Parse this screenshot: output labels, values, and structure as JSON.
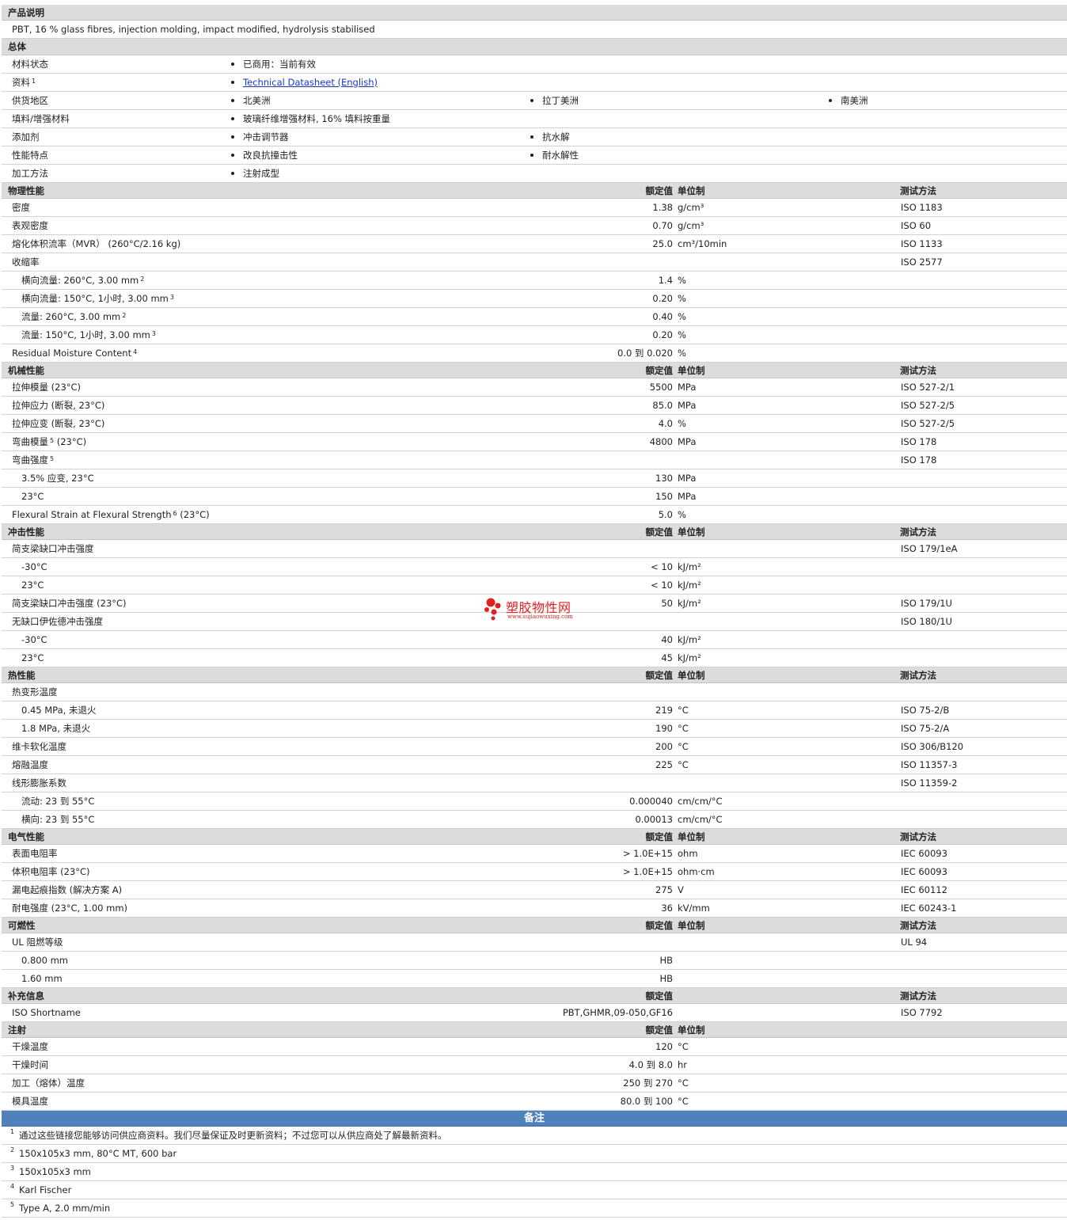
{
  "sections": [
    {
      "type": "hdr",
      "name": "产品说明"
    },
    {
      "type": "desc",
      "text": "PBT, 16 % glass fibres, injection molding, impact modified, hydrolysis stabilised"
    },
    {
      "type": "hdr",
      "name": "总体",
      "cls": "gen-hdr"
    },
    {
      "type": "gen",
      "label": "材料状态",
      "items": [
        "已商用：当前有效"
      ]
    },
    {
      "type": "gen",
      "label": "资料",
      "sup": "1",
      "items": [
        "Technical Datasheet (English)"
      ],
      "link": true
    },
    {
      "type": "gen",
      "label": "供货地区",
      "items": [
        "北美洲",
        "拉丁美洲",
        "南美洲"
      ]
    },
    {
      "type": "gen",
      "label": "填料/增强材料",
      "items": [
        "玻璃纤维增强材料, 16% 填料按重量"
      ]
    },
    {
      "type": "gen",
      "label": "添加剂",
      "items": [
        "冲击调节器",
        "抗水解"
      ]
    },
    {
      "type": "gen",
      "label": "性能特点",
      "items": [
        "改良抗撞击性",
        "耐水解性"
      ]
    },
    {
      "type": "gen",
      "label": "加工方法",
      "items": [
        "注射成型"
      ]
    },
    {
      "type": "hdr",
      "name": "物理性能",
      "h_val": "额定值",
      "h_unit": "单位制",
      "h_test": "测试方法"
    },
    {
      "type": "prop",
      "label": "密度",
      "value": "1.38",
      "unit": "g/cm³",
      "test": "ISO 1183"
    },
    {
      "type": "prop",
      "label": "表观密度",
      "value": "0.70",
      "unit": "g/cm³",
      "test": "ISO 60"
    },
    {
      "type": "prop",
      "label": "熔化体积流率（MVR） (260°C/2.16 kg)",
      "value": "25.0",
      "unit": "cm³/10min",
      "test": "ISO 1133"
    },
    {
      "type": "prop",
      "label": "收缩率",
      "test": "ISO 2577"
    },
    {
      "type": "prop",
      "sub": true,
      "label": "横向流量: 260°C, 3.00 mm",
      "sup": "2",
      "value": "1.4",
      "unit": "%"
    },
    {
      "type": "prop",
      "sub": true,
      "label": "横向流量: 150°C, 1小时, 3.00 mm",
      "sup": "3",
      "value": "0.20",
      "unit": "%"
    },
    {
      "type": "prop",
      "sub": true,
      "label": "流量: 260°C, 3.00 mm",
      "sup": "2",
      "value": "0.40",
      "unit": "%"
    },
    {
      "type": "prop",
      "sub": true,
      "label": "流量: 150°C, 1小时, 3.00 mm",
      "sup": "3",
      "value": "0.20",
      "unit": "%"
    },
    {
      "type": "prop",
      "label": "Residual Moisture Content",
      "sup": "4",
      "value": "0.0 到  0.020",
      "unit": "%"
    },
    {
      "type": "hdr",
      "name": "机械性能",
      "h_val": "额定值",
      "h_unit": "单位制",
      "h_test": "测试方法"
    },
    {
      "type": "prop",
      "label": "拉伸模量 (23°C)",
      "value": "5500",
      "unit": "MPa",
      "test": "ISO 527-2/1"
    },
    {
      "type": "prop",
      "label": "拉伸应力 (断裂, 23°C)",
      "value": "85.0",
      "unit": "MPa",
      "test": "ISO 527-2/5"
    },
    {
      "type": "prop",
      "label": "拉伸应变 (断裂, 23°C)",
      "value": "4.0",
      "unit": "%",
      "test": "ISO 527-2/5"
    },
    {
      "type": "prop",
      "label": "弯曲模量",
      "sup": "5",
      "label2": " (23°C)",
      "value": "4800",
      "unit": "MPa",
      "test": "ISO 178"
    },
    {
      "type": "prop",
      "label": "弯曲强度",
      "sup": "5",
      "test": "ISO 178"
    },
    {
      "type": "prop",
      "sub": true,
      "label": "3.5% 应变, 23°C",
      "value": "130",
      "unit": "MPa"
    },
    {
      "type": "prop",
      "sub": true,
      "label": "23°C",
      "value": "150",
      "unit": "MPa"
    },
    {
      "type": "prop",
      "label": "Flexural Strain at Flexural Strength",
      "sup": "6",
      "label2": " (23°C)",
      "value": "5.0",
      "unit": "%"
    },
    {
      "type": "hdr",
      "name": "冲击性能",
      "h_val": "额定值",
      "h_unit": "单位制",
      "h_test": "测试方法"
    },
    {
      "type": "prop",
      "label": "简支梁缺口冲击强度",
      "test": "ISO 179/1eA"
    },
    {
      "type": "prop",
      "sub": true,
      "label": "-30°C",
      "value": "< 10",
      "unit": "kJ/m²"
    },
    {
      "type": "prop",
      "sub": true,
      "label": "23°C",
      "value": "< 10",
      "unit": "kJ/m²"
    },
    {
      "type": "prop",
      "label": "简支梁缺口冲击强度 (23°C)",
      "value": "50",
      "unit": "kJ/m²",
      "test": "ISO 179/1U"
    },
    {
      "type": "prop",
      "label": "无缺口伊佐德冲击强度",
      "test": "ISO 180/1U"
    },
    {
      "type": "prop",
      "sub": true,
      "label": "-30°C",
      "value": "40",
      "unit": "kJ/m²"
    },
    {
      "type": "prop",
      "sub": true,
      "label": "23°C",
      "value": "45",
      "unit": "kJ/m²"
    },
    {
      "type": "hdr",
      "name": "热性能",
      "h_val": "额定值",
      "h_unit": "单位制",
      "h_test": "测试方法"
    },
    {
      "type": "prop",
      "label": "热变形温度"
    },
    {
      "type": "prop",
      "sub": true,
      "label": "0.45 MPa, 未退火",
      "value": "219",
      "unit": "°C",
      "test": "ISO 75-2/B"
    },
    {
      "type": "prop",
      "sub": true,
      "label": "1.8 MPa, 未退火",
      "value": "190",
      "unit": "°C",
      "test": "ISO 75-2/A"
    },
    {
      "type": "prop",
      "label": "维卡软化温度",
      "value": "200",
      "unit": "°C",
      "test": "ISO 306/B120"
    },
    {
      "type": "prop",
      "label": "熔融温度",
      "value": "225",
      "unit": "°C",
      "test": "ISO 11357-3"
    },
    {
      "type": "prop",
      "label": "线形膨胀系数",
      "test": "ISO 11359-2"
    },
    {
      "type": "prop",
      "sub": true,
      "label": "流动: 23 到  55°C",
      "value": "0.000040",
      "unit": "cm/cm/°C"
    },
    {
      "type": "prop",
      "sub": true,
      "label": "横向: 23 到  55°C",
      "value": "0.00013",
      "unit": "cm/cm/°C"
    },
    {
      "type": "hdr",
      "name": "电气性能",
      "h_val": "额定值",
      "h_unit": "单位制",
      "h_test": "测试方法"
    },
    {
      "type": "prop",
      "label": "表面电阻率",
      "value": "> 1.0E+15",
      "unit": "ohm",
      "test": "IEC 60093"
    },
    {
      "type": "prop",
      "label": "体积电阻率 (23°C)",
      "value": "> 1.0E+15",
      "unit": "ohm·cm",
      "test": "IEC 60093"
    },
    {
      "type": "prop",
      "label": "漏电起痕指数 (解决方案 A)",
      "value": "275",
      "unit": "V",
      "test": "IEC 60112"
    },
    {
      "type": "prop",
      "label": "耐电强度 (23°C, 1.00 mm)",
      "value": "36",
      "unit": "kV/mm",
      "test": "IEC 60243-1"
    },
    {
      "type": "hdr",
      "name": "可燃性",
      "h_val": "额定值",
      "h_unit": "单位制",
      "h_test": "测试方法"
    },
    {
      "type": "prop",
      "label": "UL 阻燃等级",
      "test": "UL 94"
    },
    {
      "type": "prop",
      "sub": true,
      "label": "0.800 mm",
      "value": "HB"
    },
    {
      "type": "prop",
      "sub": true,
      "label": "1.60 mm",
      "value": "HB"
    },
    {
      "type": "hdr",
      "name": "补充信息",
      "h_val": "额定值",
      "h_test": "测试方法"
    },
    {
      "type": "prop",
      "label": "ISO Shortname",
      "value": "PBT,GHMR,09-050,GF16",
      "test": "ISO 7792"
    },
    {
      "type": "hdr",
      "name": "注射",
      "h_val": "额定值",
      "h_unit": "单位制"
    },
    {
      "type": "prop",
      "label": "干燥温度",
      "value": "120",
      "unit": "°C"
    },
    {
      "type": "prop",
      "label": "干燥时间",
      "value": "4.0 到  8.0",
      "unit": "hr"
    },
    {
      "type": "prop",
      "label": "加工（熔体）温度",
      "value": "250 到  270",
      "unit": "°C"
    },
    {
      "type": "prop",
      "label": "模具温度",
      "value": "80.0 到  100",
      "unit": "°C"
    },
    {
      "type": "banner",
      "name": "备注"
    },
    {
      "type": "note",
      "num": "1",
      "text": "通过这些链接您能够访问供应商资料。我们尽量保证及时更新资料；不过您可以从供应商处了解最新资料。"
    },
    {
      "type": "note",
      "num": "2",
      "text": "150x105x3 mm, 80°C MT, 600 bar"
    },
    {
      "type": "note",
      "num": "3",
      "text": "150x105x3 mm"
    },
    {
      "type": "note",
      "num": "4",
      "text": "Karl Fischer"
    },
    {
      "type": "note",
      "num": "5",
      "text": "Type A, 2.0 mm/min"
    }
  ],
  "watermark": {
    "name": "塑胶物性网",
    "url": "www.sujiaowuxing.com",
    "color": "#e02020"
  }
}
